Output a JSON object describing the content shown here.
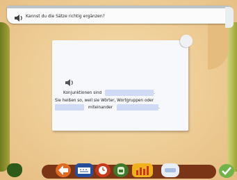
{
  "banner": {
    "instruction": "Kannst du die Sätze richtig ergänzen?"
  },
  "exercise": {
    "line1_prefix": "Konjunktionen sind",
    "line1_suffix": ".",
    "line2": "Sie heißen so, weil sie Wörter, Wortgruppen oder",
    "line3_middle": "miteinander",
    "line3_suffix": "."
  },
  "toolbar": {
    "icons": [
      "potion-icon",
      "exit-arrow-icon",
      "keyboard-icon",
      "clock-icon",
      "backpack-icon",
      "chart-icon",
      "eraser-icon",
      "checkmark-icon"
    ]
  },
  "colors": {
    "accent": "#cfdaf4",
    "toolbar": "#7a3517",
    "ok": "#6fb34a"
  }
}
